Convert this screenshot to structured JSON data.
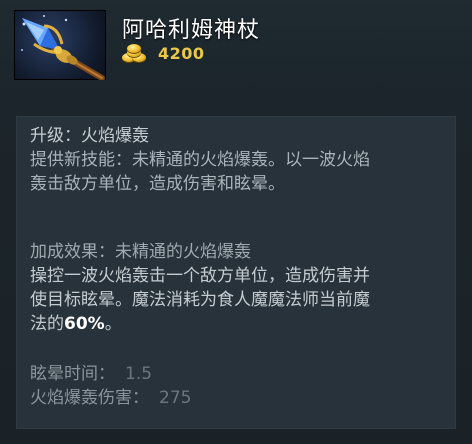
{
  "item": {
    "name": "阿哈利姆神杖",
    "icon": "aghanims-scepter-icon",
    "cost": "4200",
    "cost_icon": "gold-coins-icon"
  },
  "ability": {
    "title": "升级：火焰爆轰",
    "lines": [
      "提供新技能：未精通的火焰爆轰。以一波火焰",
      "轰击敌方单位，造成伤害和眩晕。"
    ]
  },
  "bonus": {
    "title": "加成效果：未精通的火焰爆轰",
    "lines": [
      "操控一波火焰轰击一个敌方单位，造成伤害并",
      "使目标眩晕。魔法消耗为食人魔魔法师当前魔"
    ],
    "line3_prefix": "法的",
    "line3_highlight": "60%",
    "line3_suffix": "。"
  },
  "stats": [
    {
      "label": "眩晕时间：",
      "value": "1.5"
    },
    {
      "label": "火焰爆轰伤害：",
      "value": "275"
    }
  ],
  "colors": {
    "gold": "#e9c84a",
    "background": "#1b2329",
    "panel": "#27323a"
  }
}
